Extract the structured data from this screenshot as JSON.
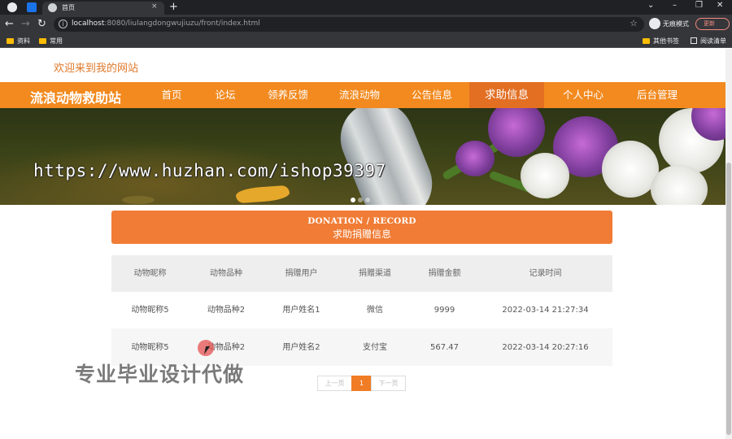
{
  "browser": {
    "tab_title": "首页",
    "tab_close": "×",
    "new_tab": "+",
    "url_host": "localhost",
    "url_path": ":8080/liulangdongwujiuzu/front/index.html",
    "incognito_label": "无痕模式",
    "update_label": "更新",
    "bookmarks": [
      "资料",
      "常用"
    ],
    "other_bookmarks": "其他书签",
    "reading_list": "阅读清单"
  },
  "site": {
    "welcome": "欢迎来到我的网站",
    "brand": "流浪动物救助站",
    "nav": [
      "首页",
      "论坛",
      "领养反馈",
      "流浪动物",
      "公告信息",
      "求助信息",
      "个人中心",
      "后台管理"
    ],
    "active_nav": "求助信息"
  },
  "banner": {
    "watermark": "https://www.huzhan.com/ishop39397"
  },
  "section": {
    "title_en": "DONATION / RECORD",
    "title_cn": "求助捐赠信息"
  },
  "table": {
    "headers": [
      "动物昵称",
      "动物品种",
      "捐赠用户",
      "捐赠渠道",
      "捐赠金额",
      "记录时间"
    ],
    "rows": [
      [
        "动物昵称5",
        "动物品种2",
        "用户姓名1",
        "微信",
        "9999",
        "2022-03-14 21:27:34"
      ],
      [
        "动物昵称5",
        "动物品种2",
        "用户姓名2",
        "支付宝",
        "567.47",
        "2022-03-14 20:27:16"
      ]
    ]
  },
  "pager": {
    "prev": "上一页",
    "current": "1",
    "next": "下一页"
  },
  "overlay": {
    "watermark": "专业毕业设计代做"
  },
  "colors": {
    "nav_bg": "#f28a1f",
    "nav_active": "#e36f23",
    "accent": "#f07c35",
    "welcome": "#e0782a"
  }
}
